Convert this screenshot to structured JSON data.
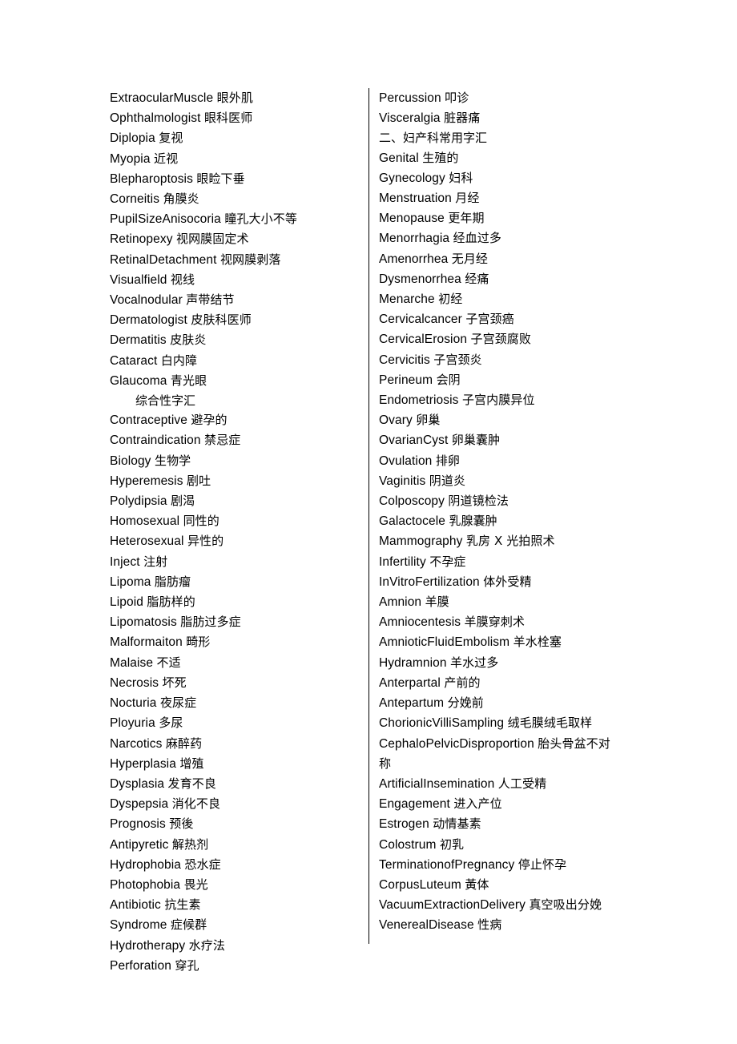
{
  "document": {
    "page_background": "#ffffff",
    "text_color": "#000000",
    "divider_color": "#000000",
    "layout": "two-column glossary with vertical rule between columns"
  },
  "left_column": {
    "entries": [
      {
        "term": "ExtraocularMuscle",
        "gloss": "眼外肌"
      },
      {
        "term": "Ophthalmologist",
        "gloss": "眼科医师"
      },
      {
        "term": "Diplopia",
        "gloss": "复视"
      },
      {
        "term": "Myopia",
        "gloss": "近视"
      },
      {
        "term": "Blepharoptosis",
        "gloss": "眼睑下垂"
      },
      {
        "term": "Corneitis",
        "gloss": "角膜炎"
      },
      {
        "term": "PupilSizeAnisocoria",
        "gloss": "瞳孔大小不等"
      },
      {
        "term": "Retinopexy",
        "gloss": "视网膜固定术"
      },
      {
        "term": "RetinalDetachment",
        "gloss": "视网膜剥落"
      },
      {
        "term": "Visualfield",
        "gloss": "视线"
      },
      {
        "term": "Vocalnodular",
        "gloss": "声带结节"
      },
      {
        "term": "Dermatologist",
        "gloss": "皮肤科医师"
      },
      {
        "term": "Dermatitis",
        "gloss": "皮肤炎"
      },
      {
        "term": "Cataract",
        "gloss": "白内障"
      },
      {
        "term": "Glaucoma",
        "gloss": "青光眼"
      },
      {
        "heading": "综合性字汇",
        "indented": true
      },
      {
        "term": "Contraceptive",
        "gloss": "避孕的"
      },
      {
        "term": "Contraindication",
        "gloss": "禁忌症"
      },
      {
        "term": "Biology",
        "gloss": "生物学"
      },
      {
        "term": "Hyperemesis",
        "gloss": "剧吐"
      },
      {
        "term": "Polydipsia",
        "gloss": "剧渴"
      },
      {
        "term": "Homosexual",
        "gloss": "同性的"
      },
      {
        "term": "Heterosexual",
        "gloss": "异性的"
      },
      {
        "term": "Inject",
        "gloss": "注射"
      },
      {
        "term": "Lipoma",
        "gloss": "脂肪瘤"
      },
      {
        "term": "Lipoid",
        "gloss": "脂肪样的"
      },
      {
        "term": "Lipomatosis",
        "gloss": "脂肪过多症"
      },
      {
        "term": "Malformaiton",
        "gloss": "畸形"
      },
      {
        "term": "Malaise",
        "gloss": "不适"
      },
      {
        "term": "Necrosis",
        "gloss": "坏死"
      },
      {
        "term": "Nocturia",
        "gloss": "夜尿症"
      },
      {
        "term": "Ployuria",
        "gloss": "多尿"
      },
      {
        "term": "Narcotics",
        "gloss": "麻醉药"
      },
      {
        "term": "Hyperplasia",
        "gloss": "增殖"
      },
      {
        "term": "Dysplasia",
        "gloss": "发育不良"
      },
      {
        "term": "Dyspepsia",
        "gloss": "消化不良"
      },
      {
        "term": "Prognosis",
        "gloss": "预後"
      },
      {
        "term": "Antipyretic",
        "gloss": "解热剂"
      },
      {
        "term": "Hydrophobia",
        "gloss": "恐水症"
      },
      {
        "term": "Photophobia",
        "gloss": "畏光"
      },
      {
        "term": "Antibiotic",
        "gloss": "抗生素"
      },
      {
        "term": "Syndrome",
        "gloss": "症候群"
      },
      {
        "term": "Hydrotherapy",
        "gloss": "水疗法"
      },
      {
        "term": "Perforation",
        "gloss": "穿孔"
      }
    ]
  },
  "right_column": {
    "entries": [
      {
        "term": "Percussion",
        "gloss": "叩诊"
      },
      {
        "term": "Visceralgia",
        "gloss": "脏器痛"
      },
      {
        "heading": "二、妇产科常用字汇",
        "indented": false
      },
      {
        "term": "Genital",
        "gloss": "生殖的"
      },
      {
        "term": "Gynecology",
        "gloss": "妇科"
      },
      {
        "term": "Menstruation",
        "gloss": "月经"
      },
      {
        "term": "Menopause",
        "gloss": "更年期"
      },
      {
        "term": "Menorrhagia",
        "gloss": "经血过多"
      },
      {
        "term": "Amenorrhea",
        "gloss": "无月经"
      },
      {
        "term": "Dysmenorrhea",
        "gloss": "经痛"
      },
      {
        "term": "Menarche",
        "gloss": "初经"
      },
      {
        "term": "Cervicalcancer",
        "gloss": "子宫颈癌"
      },
      {
        "term": "CervicalErosion",
        "gloss": "子宫颈腐败"
      },
      {
        "term": "Cervicitis",
        "gloss": "子宫颈炎"
      },
      {
        "term": "Perineum",
        "gloss": "会阴"
      },
      {
        "term": "Endometriosis",
        "gloss": "子宫内膜异位"
      },
      {
        "term": "Ovary",
        "gloss": "卵巢"
      },
      {
        "term": "OvarianCyst",
        "gloss": "卵巢囊肿"
      },
      {
        "term": "Ovulation",
        "gloss": "排卵"
      },
      {
        "term": "Vaginitis",
        "gloss": "阴道炎"
      },
      {
        "term": "Colposcopy",
        "gloss": "阴道镜检法"
      },
      {
        "term": "Galactocele",
        "gloss": "乳腺囊肿"
      },
      {
        "term": "Mammography",
        "gloss": "乳房 X 光拍照术"
      },
      {
        "term": "Infertility",
        "gloss": "不孕症"
      },
      {
        "term": "InVitroFertilization",
        "gloss": "体外受精"
      },
      {
        "term": "Amnion",
        "gloss": "羊膜"
      },
      {
        "term": "Amniocentesis",
        "gloss": "羊膜穿刺术"
      },
      {
        "term": "AmnioticFluidEmbolism",
        "gloss": "羊水栓塞"
      },
      {
        "term": "Hydramnion",
        "gloss": "羊水过多"
      },
      {
        "term": "Anterpartal",
        "gloss": "产前的"
      },
      {
        "term": "Antepartum",
        "gloss": "分娩前"
      },
      {
        "term": "ChorionicVilliSampling",
        "gloss": "绒毛膜绒毛取样"
      },
      {
        "term": "CephaloPelvicDisproportion",
        "gloss": "胎头骨盆不对称"
      },
      {
        "term": "ArtificialInsemination",
        "gloss": "人工受精"
      },
      {
        "term": "Engagement",
        "gloss": "进入产位"
      },
      {
        "term": "Estrogen",
        "gloss": "动情基素"
      },
      {
        "term": "Colostrum",
        "gloss": "初乳"
      },
      {
        "term": "TerminationofPregnancy",
        "gloss": "停止怀孕"
      },
      {
        "term": "CorpusLuteum",
        "gloss": "黃体"
      },
      {
        "term": "VacuumExtractionDelivery",
        "gloss": "真空吸出分娩"
      },
      {
        "term": "VenerealDisease",
        "gloss": "性病"
      }
    ]
  }
}
